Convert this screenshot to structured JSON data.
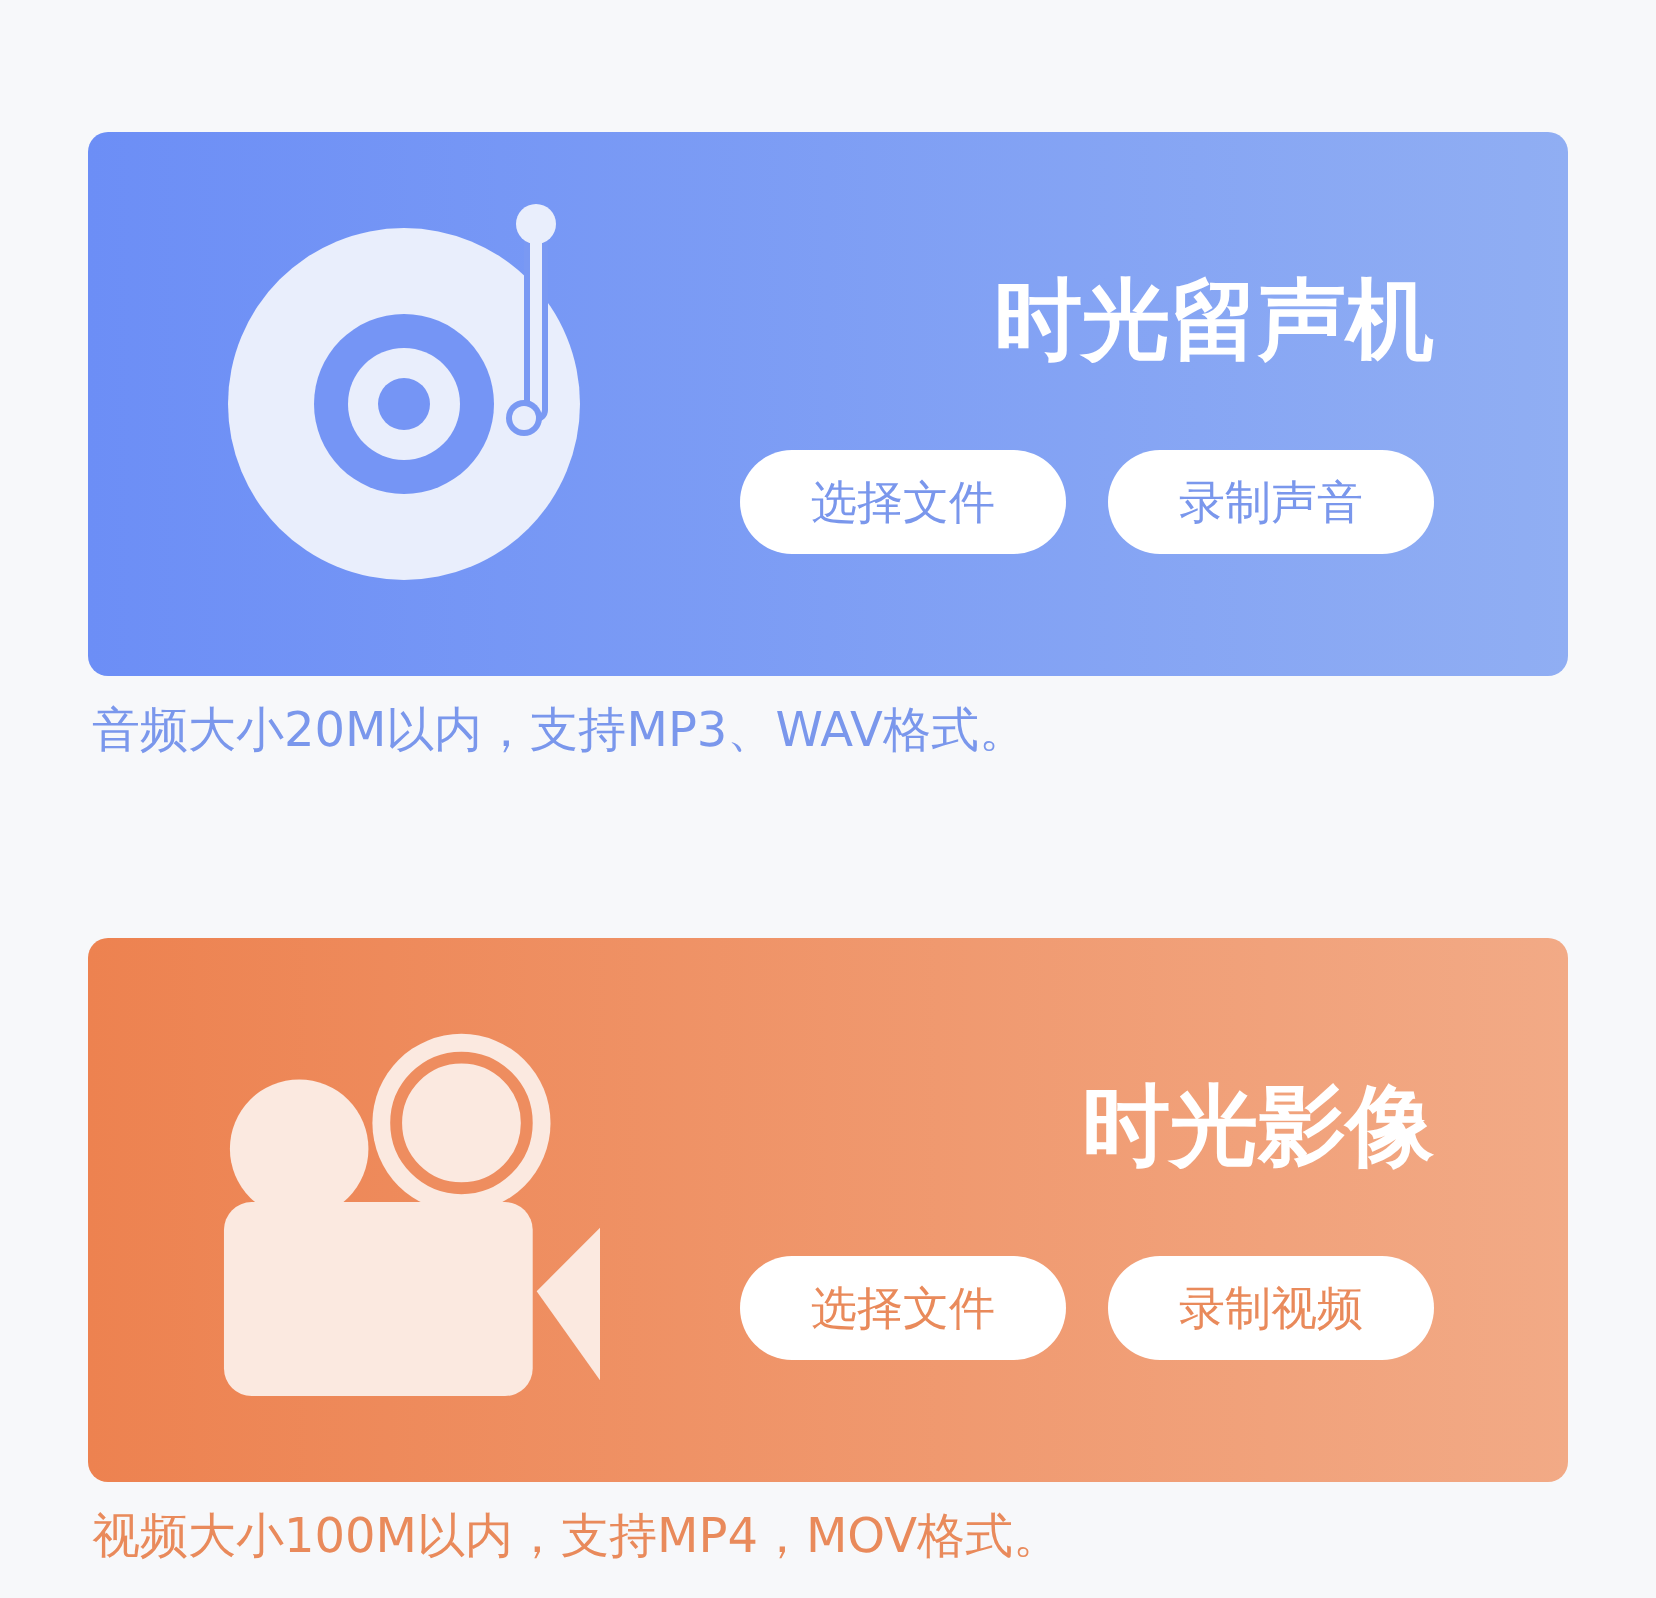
{
  "sections": [
    {
      "kind": "audio",
      "title": "时光留声机",
      "buttons": [
        "选择文件",
        "录制声音"
      ],
      "note": "音频大小20M以内，支持MP3、WAV格式。"
    },
    {
      "kind": "video",
      "title": "时光影像",
      "buttons": [
        "选择文件",
        "录制视频"
      ],
      "note": "视频大小100M以内，支持MP4，MOV格式。"
    }
  ]
}
